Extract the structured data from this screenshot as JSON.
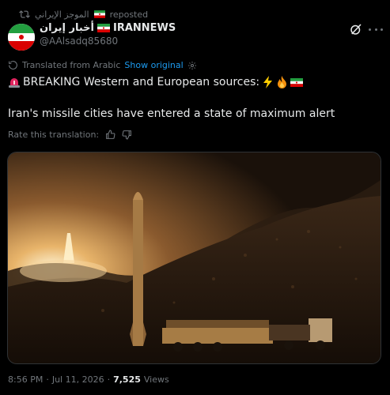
{
  "repost": {
    "reposter": "الموجز الإيراني",
    "label": "reposted"
  },
  "author": {
    "name_ar": "أخبار إيران",
    "name_en": "IRANNEWS",
    "handle": "@AAlsadq85680"
  },
  "translation": {
    "note": "Translated from Arabic",
    "show_original": "Show original"
  },
  "tweet": {
    "line1": "BREAKING Western and European sources:",
    "line2": "Iran's missile cities have entered a state of maximum alert"
  },
  "rate": {
    "label": "Rate this translation:"
  },
  "footer": {
    "time": "8:56 PM",
    "sep1": "·",
    "date": "Jul 11, 2026",
    "sep2": "·",
    "views": "7,525",
    "views_label": "Views"
  },
  "colors": {
    "link": "#1d9bf0",
    "muted": "#71767b",
    "text": "#e7e9ea",
    "background": "#000000"
  },
  "icons": [
    "repost-icon",
    "iran-flag-icon",
    "grok-icon",
    "more-icon",
    "translate-icon",
    "gear-icon",
    "siren-emoji",
    "lightning-emoji",
    "fire-emoji",
    "thumbs-up-icon",
    "thumbs-down-icon"
  ]
}
